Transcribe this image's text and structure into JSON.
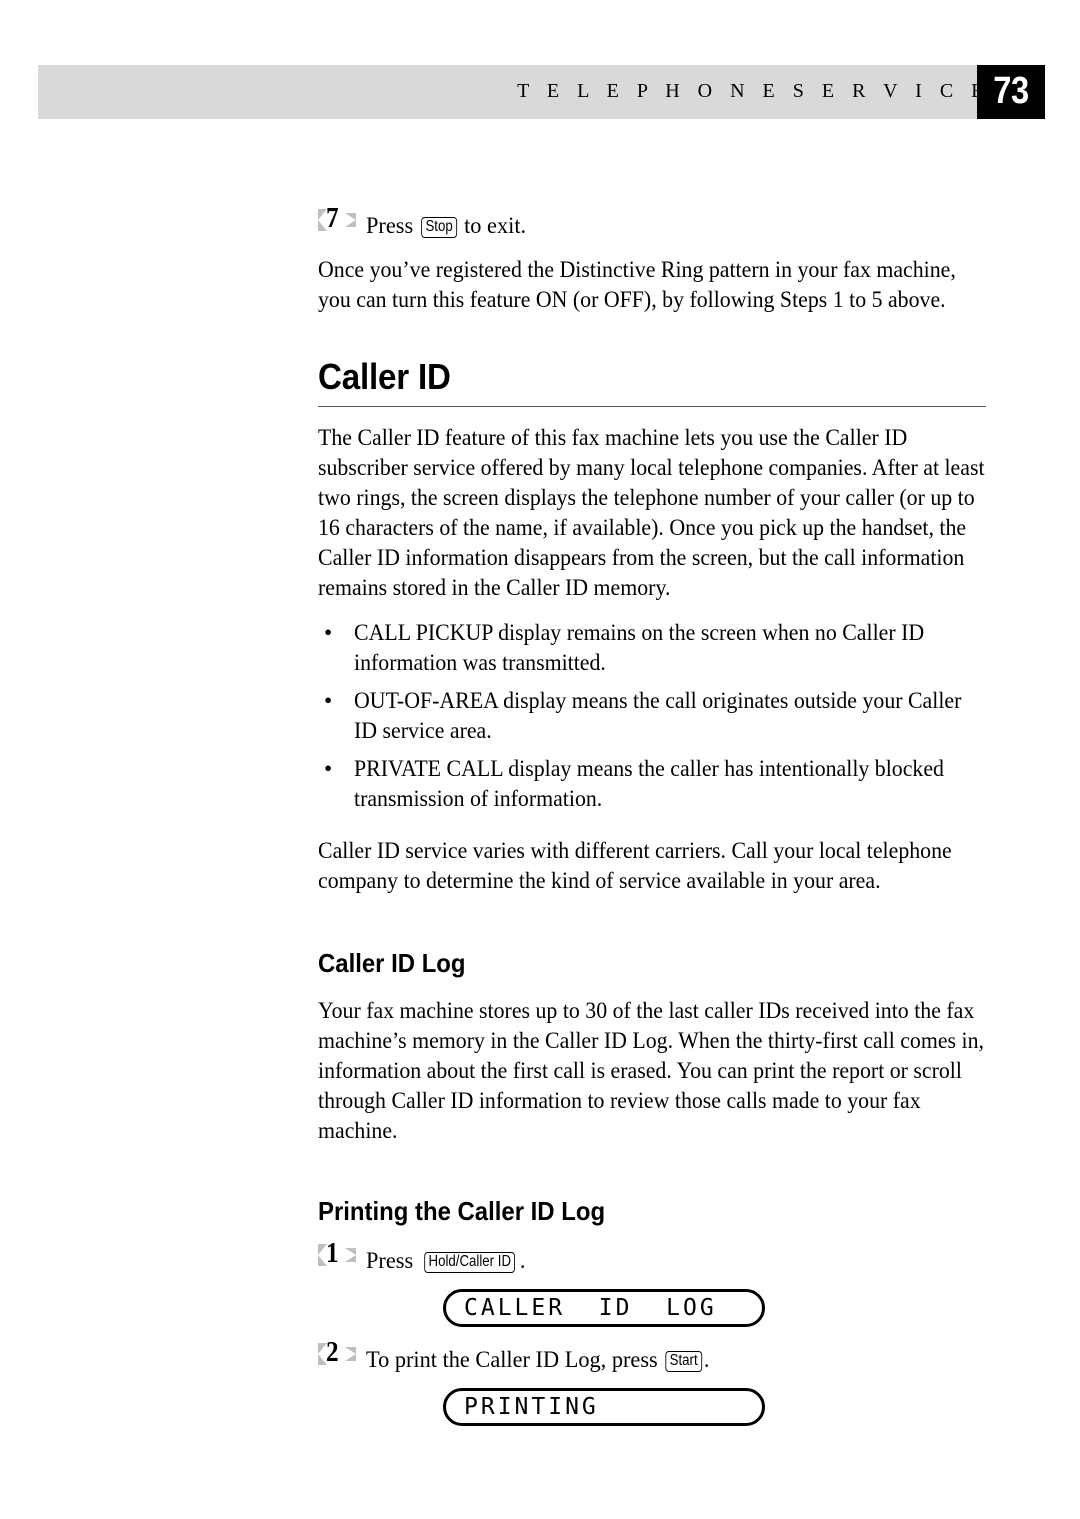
{
  "header": {
    "title": "T E L E P H O N E   S E R V I C E S",
    "page_number": "73",
    "bar_color": "#d9d9d9",
    "page_box_color": "#000000"
  },
  "steps_top": [
    {
      "number": "7",
      "text_before": "Press",
      "key": "Stop",
      "text_after": "to exit."
    }
  ],
  "intro_paragraph": "Once you’ve registered the Distinctive Ring pattern in your fax machine, you can turn this feature ON (or OFF), by following Steps 1 to 5 above.",
  "section": {
    "heading": "Caller ID",
    "paragraph": "The Caller ID feature of this fax machine lets you use the Caller ID subscriber service offered by many local telephone companies. After at least two rings, the screen displays the telephone number of your caller (or up to 16 characters of the name, if available). Once you pick up the handset, the Caller ID information disappears from the screen, but the call information remains stored in the Caller ID memory.",
    "bullet_marker": "•",
    "bullets": [
      "CALL PICKUP display remains on the screen when no Caller ID information was transmitted.",
      "OUT-OF-AREA display means the call originates outside your Caller ID service area.",
      "PRIVATE CALL display means the caller has intentionally blocked transmission of information."
    ],
    "closing_paragraph": "Caller ID service varies with different carriers. Call your local telephone company to determine the kind of service available in your area."
  },
  "subsection_log": {
    "heading": "Caller ID Log",
    "paragraph": "Your fax machine stores up to 30 of the last caller IDs received into the fax machine’s memory in the Caller ID Log. When the thirty-first call comes in, information about the first call is erased. You can print the report or scroll through Caller ID information to review those calls made to your fax machine."
  },
  "subsection_printing": {
    "heading": "Printing the Caller ID Log",
    "step1": {
      "number": "1",
      "text_before": "Press",
      "key": "Hold/Caller ID",
      "text_after": "."
    },
    "lcd1": "CALLER  ID  LOG",
    "step2": {
      "number": "2",
      "text_before": "To print the Caller ID Log, press",
      "key": "Start",
      "text_after": "."
    },
    "lcd2": "PRINTING"
  }
}
